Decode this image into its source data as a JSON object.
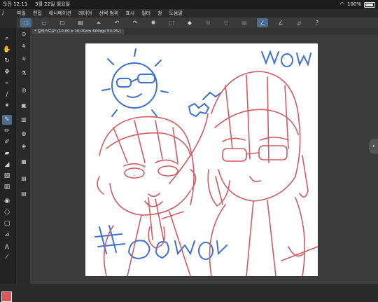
{
  "status": {
    "time": "오전 12:11",
    "date": "3월 22일 월요일",
    "battery": "100%"
  },
  "menu": [
    "파일",
    "편집",
    "애니메이션",
    "레이어",
    "선택 범위",
    "표시",
    "필터",
    "창",
    "도움말"
  ],
  "document_tab": "* 일러스트4* (10.00 x 10.00cm 600dpi 53.2%)",
  "canvas_text": {
    "wow": "wow",
    "hash": "#",
    "caption": "Couwo"
  },
  "colors": {
    "main_color": "#d9595b",
    "sketch_red": "#d15a63",
    "sketch_blue": "#3f6fcf"
  },
  "icons": {
    "toolbar": [
      "cursor-icon",
      "frame-icon",
      "clear-icon",
      "fill-icon",
      "horizon-icon",
      "undo-icon",
      "redo-icon",
      "spinner-icon",
      "transform-icon",
      "paint-bucket-icon",
      "crop-icon",
      "rotate-icon",
      "layer-icon",
      "pen-icon",
      "brush-icon",
      "ruler-icon",
      "help-icon"
    ],
    "tools": [
      "magnify-icon",
      "hand-icon",
      "rotate-icon",
      "move-icon",
      "lasso-icon",
      "eyedropper-icon",
      "spark-icon",
      "pen-icon",
      "brush-icon",
      "airbrush-icon",
      "eraser-icon",
      "fill-icon",
      "gradient-icon",
      "figure-icon",
      "blend-icon",
      "shape-icon",
      "text-icon",
      "color-swatch-icon"
    ]
  }
}
